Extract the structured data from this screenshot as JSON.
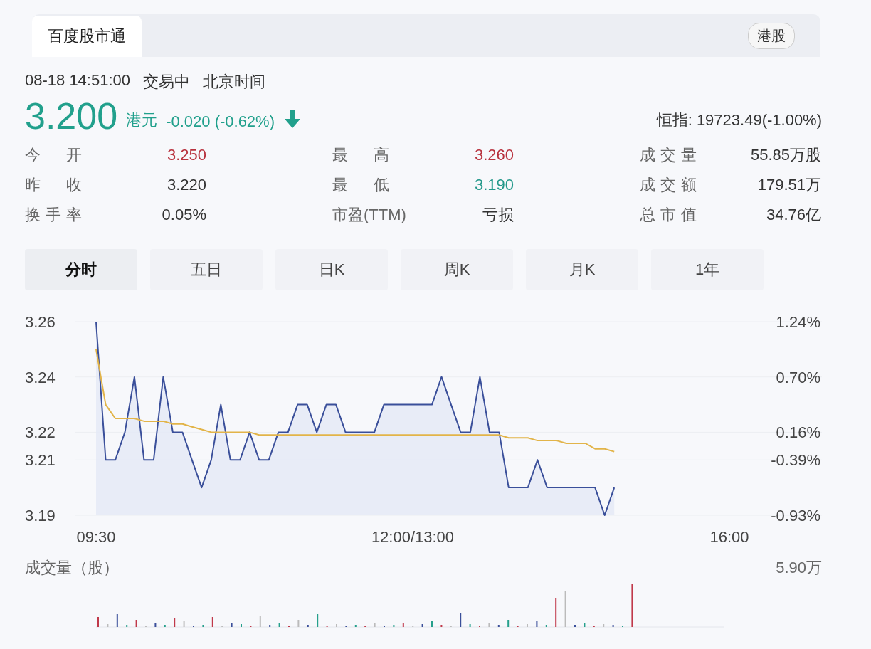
{
  "header": {
    "tab": "百度股市通",
    "market_badge": "港股"
  },
  "status": {
    "datetime": "08-18 14:51:00",
    "trading_state": "交易中",
    "timezone": "北京时间"
  },
  "quote": {
    "price": "3.200",
    "currency": "港元",
    "change": "-0.020 (-0.62%)",
    "falling": true,
    "index": "恒指: 19723.49(-1.00%)"
  },
  "stats": [
    {
      "label": "今 开",
      "value": "3.250",
      "color": "#b8323e"
    },
    {
      "label": "最 高",
      "value": "3.260",
      "color": "#b8323e"
    },
    {
      "label": "成交量",
      "value": "55.85万股",
      "color": "#333333"
    },
    {
      "label": "昨 收",
      "value": "3.220",
      "color": "#333333"
    },
    {
      "label": "最 低",
      "value": "3.190",
      "color": "#22988a"
    },
    {
      "label": "成交额",
      "value": "179.51万",
      "color": "#333333"
    },
    {
      "label": "换手率",
      "value": "0.05%",
      "color": "#333333"
    },
    {
      "label": "市盈(TTM)",
      "value": "亏损",
      "color": "#333333"
    },
    {
      "label": "总市值",
      "value": "34.76亿",
      "color": "#333333"
    }
  ],
  "tabs": [
    {
      "label": "分时",
      "selected": true
    },
    {
      "label": "五日",
      "selected": false
    },
    {
      "label": "日K",
      "selected": false
    },
    {
      "label": "周K",
      "selected": false
    },
    {
      "label": "月K",
      "selected": false
    },
    {
      "label": "1年",
      "selected": false
    }
  ],
  "chart": {
    "right_labels": [
      "1.24%",
      "0.70%",
      "0.16%",
      "-0.39%",
      "-0.93%"
    ],
    "chart_data": {
      "type": "line",
      "grid": true,
      "ylim": [
        3.19,
        3.26
      ],
      "yticks": [
        3.26,
        3.24,
        3.22,
        3.21,
        3.19
      ],
      "categories": [
        "09:30",
        null,
        null,
        null,
        null,
        null,
        null,
        null,
        null,
        null,
        null,
        null,
        null,
        null,
        null,
        null,
        null,
        null,
        null,
        null,
        null,
        null,
        null,
        null,
        null,
        null,
        null,
        null,
        null,
        null,
        null,
        null,
        null,
        "12:00/13:00",
        null,
        null,
        null,
        null,
        null,
        null,
        null,
        null,
        null,
        null,
        null,
        null,
        null,
        null,
        null,
        null,
        null,
        null,
        null,
        null,
        null,
        null,
        null,
        null,
        null,
        null,
        null,
        null,
        null,
        null,
        null,
        null,
        "16:00"
      ],
      "series": [
        {
          "color": "#3a4f9a",
          "values": [
            3.26,
            3.21,
            3.21,
            3.22,
            3.24,
            3.21,
            3.21,
            3.24,
            3.22,
            3.22,
            3.21,
            3.2,
            3.21,
            3.23,
            3.21,
            3.21,
            3.22,
            3.21,
            3.21,
            3.22,
            3.22,
            3.23,
            3.23,
            3.22,
            3.23,
            3.23,
            3.22,
            3.22,
            3.22,
            3.22,
            3.23,
            3.23,
            3.23,
            3.23,
            3.23,
            3.23,
            3.24,
            3.23,
            3.22,
            3.22,
            3.24,
            3.22,
            3.22,
            3.2,
            3.2,
            3.2,
            3.21,
            3.2,
            3.2,
            3.2,
            3.2,
            3.2,
            3.2,
            3.19,
            3.2,
            null,
            null,
            null,
            null,
            null,
            null,
            null,
            null,
            null,
            null,
            null,
            null
          ]
        },
        {
          "color": "#e2b449",
          "values": [
            3.25,
            3.23,
            3.225,
            3.225,
            3.225,
            3.224,
            3.224,
            3.224,
            3.223,
            3.223,
            3.222,
            3.221,
            3.22,
            3.22,
            3.22,
            3.22,
            3.22,
            3.219,
            3.219,
            3.219,
            3.219,
            3.219,
            3.219,
            3.219,
            3.219,
            3.219,
            3.219,
            3.219,
            3.219,
            3.219,
            3.219,
            3.219,
            3.219,
            3.219,
            3.219,
            3.219,
            3.219,
            3.219,
            3.219,
            3.219,
            3.219,
            3.219,
            3.219,
            3.218,
            3.218,
            3.218,
            3.217,
            3.217,
            3.217,
            3.216,
            3.216,
            3.216,
            3.214,
            3.214,
            3.213,
            null,
            null,
            null,
            null,
            null,
            null,
            null,
            null,
            null,
            null,
            null,
            null
          ]
        }
      ]
    }
  },
  "volume": {
    "title": "成交量（股）",
    "max_label": "5.90万"
  }
}
